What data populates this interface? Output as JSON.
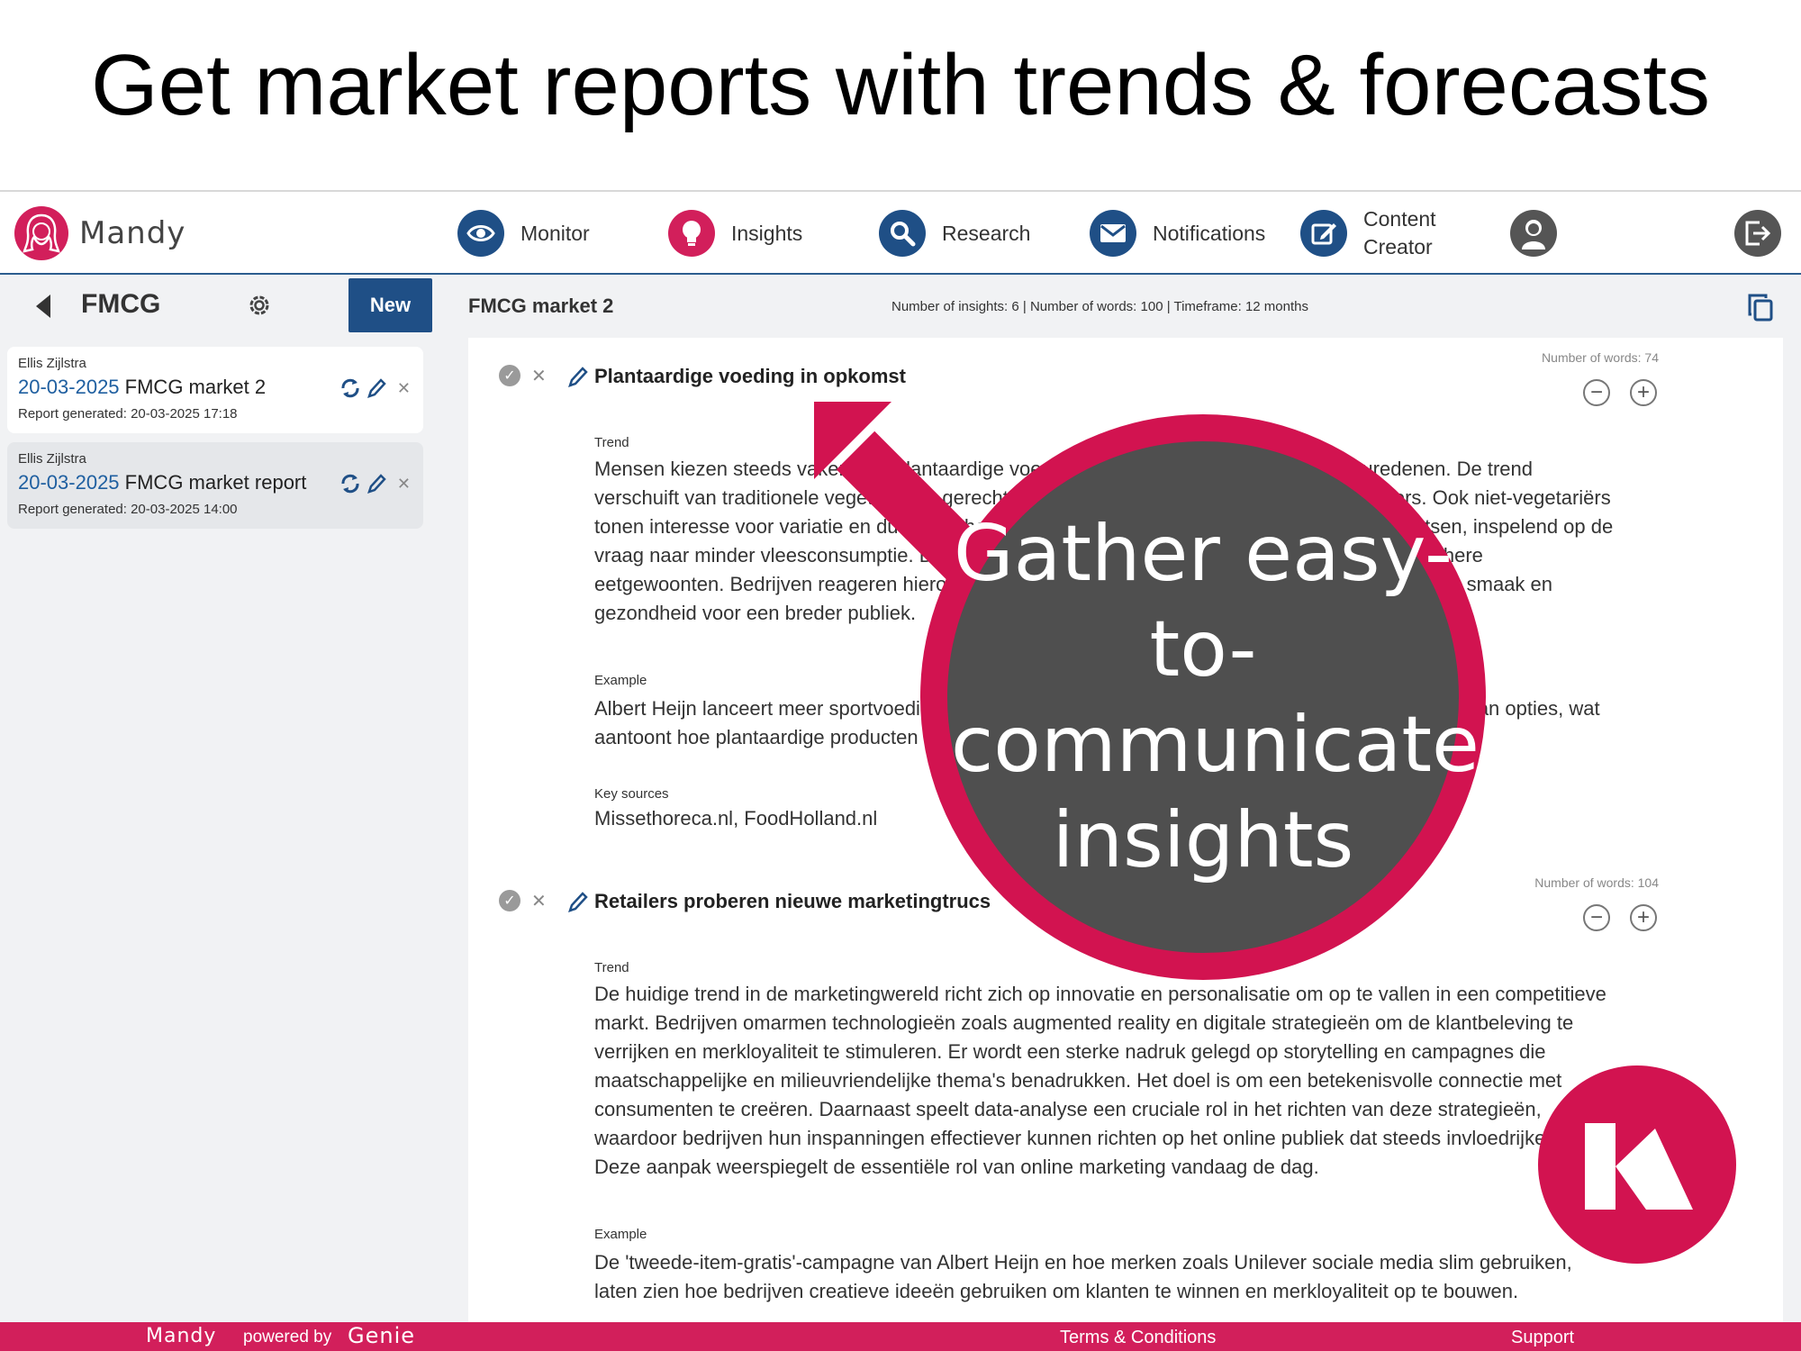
{
  "headline": "Get market reports with trends & forecasts",
  "brand": {
    "logo_text": "Mandy",
    "accent": "#d21f5b",
    "nav_blue": "#1f4f86"
  },
  "nav": {
    "items": [
      {
        "label": "Monitor",
        "icon": "eye-icon"
      },
      {
        "label": "Insights",
        "icon": "lightbulb-icon"
      },
      {
        "label": "Research",
        "icon": "search-icon"
      },
      {
        "label": "Notifications",
        "icon": "envelope-icon"
      },
      {
        "label": "Content\nCreator",
        "icon": "edit-icon"
      }
    ],
    "profile_icon": "user-icon",
    "logout_icon": "logout-icon"
  },
  "sidebar": {
    "title": "FMCG",
    "new_label": "New",
    "reports": [
      {
        "author": "Ellis Zijlstra",
        "date": "20-03-2025",
        "name": "FMCG market 2",
        "generated": "Report generated: 20-03-2025 17:18"
      },
      {
        "author": "Ellis Zijlstra",
        "date": "20-03-2025",
        "name": "FMCG market report",
        "generated": "Report generated: 20-03-2025 14:00"
      }
    ]
  },
  "main": {
    "title": "FMCG market 2",
    "meta": "Number of insights: 6 | Number of words: 100 | Timeframe: 12 months",
    "insights": [
      {
        "title": "Plantaardige voeding in opkomst",
        "words": "Number of words: 74",
        "trend_label": "Trend",
        "trend_lines": [
          "Mensen kiezen steeds vaker voor plantaardige voeding vanwege gezondheids- en milieuredenen. De trend",
          "verschuift van traditionele vegetarische gerechten naar innovatieve vlees- en zuivelvervangers. Ook niet-vegetariërs",
          "tonen interesse voor variatie en duurzaamheid. De markt groeit met producten die vlees nabootsen, inspelend op de",
          "vraag naar minder vleesconsumptie. Dit weerspiegelt een verschuiving naar gezondere en ethischere",
          "eetgewoonten. Bedrijven reageren hierop door meer plantaardig aanbod te creëren, met nadruk op smaak en",
          "gezondheid voor een breder publiek."
        ],
        "example_label": "Example",
        "example_lines": [
          "Albert Heijn lanceert meer sportvoedingsproducten en De Vegetarische Slager legt de nadruk op vegan opties, wat",
          "aantoont hoe plantaardige producten steeds gewoner worden."
        ],
        "sources_label": "Key sources",
        "sources": "Missethoreca.nl, FoodHolland.nl"
      },
      {
        "title": "Retailers proberen nieuwe marketingtrucs",
        "words": "Number of words: 104",
        "trend_label": "Trend",
        "trend_lines": [
          "De huidige trend in de marketingwereld richt zich op innovatie en personalisatie om op te vallen in een competitieve",
          "markt. Bedrijven omarmen technologieën zoals augmented reality en digitale strategieën om de klantbeleving te",
          "verrijken en merkloyaliteit te stimuleren. Er wordt een sterke nadruk gelegd op storytelling en campagnes die",
          "maatschappelijke en milieuvriendelijke thema's benadrukken. Het doel is om een betekenisvolle connectie met",
          "consumenten te creëren. Daarnaast speelt data-analyse een cruciale rol in het richten van deze strategieën,",
          "waardoor bedrijven hun inspanningen effectiever kunnen richten op het online publiek dat steeds invloedrijker wordt.",
          "Deze aanpak weerspiegelt de essentiële rol van online marketing vandaag de dag."
        ],
        "example_label": "Example",
        "example_lines": [
          "De 'tweede-item-gratis'-campagne van Albert Heijn en hoe merken zoals Unilever sociale media slim gebruiken,",
          "laten zien hoe bedrijven creatieve ideeën gebruiken om klanten te winnen en merkloyaliteit op te bouwen."
        ]
      }
    ]
  },
  "callout": {
    "text": "Gather easy-to-communicate insights",
    "ring_color": "#d21350",
    "fill_color": "#4f4f4f"
  },
  "footer": {
    "brand": "Mandy",
    "powered_by": "powered by",
    "genie": "Genie",
    "terms": "Terms & Conditions",
    "support": "Support"
  }
}
